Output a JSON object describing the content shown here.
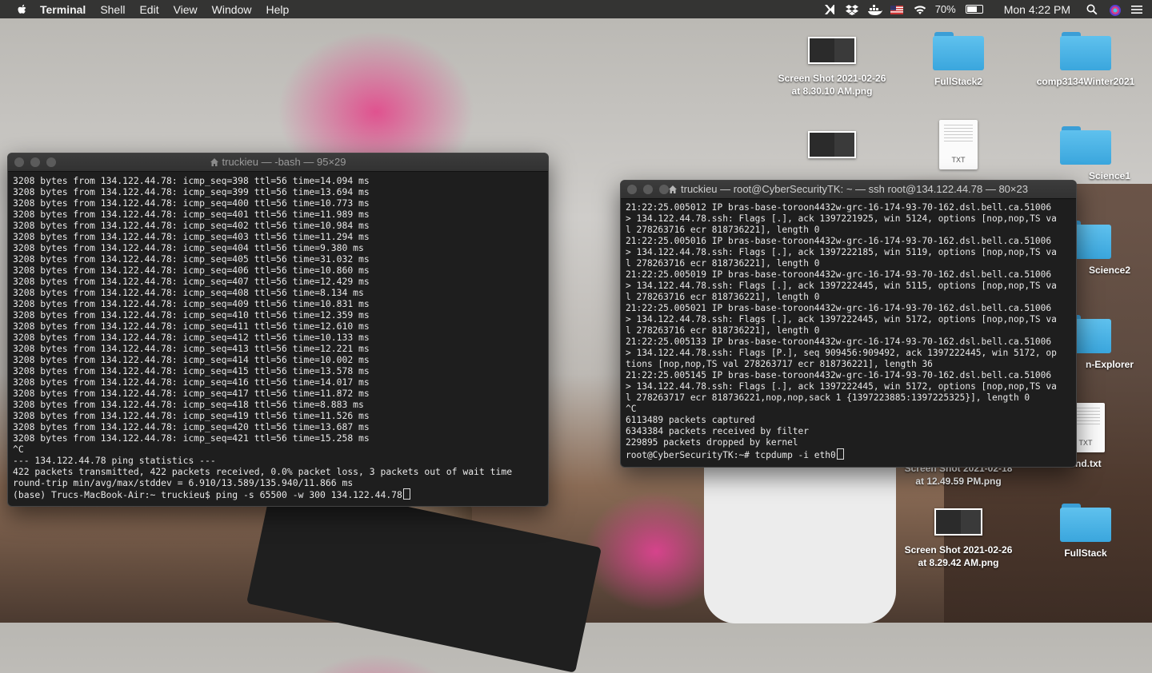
{
  "menubar": {
    "app": "Terminal",
    "menus": [
      "Shell",
      "Edit",
      "View",
      "Window",
      "Help"
    ],
    "battery_percent": "70%",
    "battery_level": 0.7,
    "clock": "Mon 4:22 PM",
    "status_icons": [
      "pinwheel-icon",
      "dropbox-icon",
      "docker-icon",
      "us-flag-icon",
      "wifi-icon",
      "battery-icon",
      "search-icon",
      "siri-icon",
      "menu-list-icon"
    ]
  },
  "desktop": {
    "icons": [
      {
        "label": "Screen Shot 2021-02-26 at 8.30.10 AM.png",
        "kind": "screenshot"
      },
      {
        "label": "FullStack2",
        "kind": "folder"
      },
      {
        "label": "comp3134Winter2021",
        "kind": "folder"
      },
      {
        "label": "",
        "kind": "screenshot"
      },
      {
        "label": "TXT",
        "kind": "txt"
      },
      {
        "label": "Science1",
        "kind": "folder"
      },
      {
        "label": "Science2",
        "kind": "folder"
      },
      {
        "label": "n-Explorer",
        "kind": "folder"
      },
      {
        "label": "Screen Shot 2021-02-18 at 12.49.59 PM.png",
        "kind": "screenshot"
      },
      {
        "label": "end.txt",
        "kind": "txt"
      },
      {
        "label": "Screen Shot 2021-02-26 at 8.29.42 AM.png",
        "kind": "screenshot"
      },
      {
        "label": "FullStack",
        "kind": "folder"
      }
    ],
    "txt_badge": "TXT"
  },
  "term1": {
    "title": "truckieu — -bash — 95×29",
    "lines": [
      "3208 bytes from 134.122.44.78: icmp_seq=398 ttl=56 time=14.094 ms",
      "3208 bytes from 134.122.44.78: icmp_seq=399 ttl=56 time=13.694 ms",
      "3208 bytes from 134.122.44.78: icmp_seq=400 ttl=56 time=10.773 ms",
      "3208 bytes from 134.122.44.78: icmp_seq=401 ttl=56 time=11.989 ms",
      "3208 bytes from 134.122.44.78: icmp_seq=402 ttl=56 time=10.984 ms",
      "3208 bytes from 134.122.44.78: icmp_seq=403 ttl=56 time=11.294 ms",
      "3208 bytes from 134.122.44.78: icmp_seq=404 ttl=56 time=9.380 ms",
      "3208 bytes from 134.122.44.78: icmp_seq=405 ttl=56 time=31.032 ms",
      "3208 bytes from 134.122.44.78: icmp_seq=406 ttl=56 time=10.860 ms",
      "3208 bytes from 134.122.44.78: icmp_seq=407 ttl=56 time=12.429 ms",
      "3208 bytes from 134.122.44.78: icmp_seq=408 ttl=56 time=8.134 ms",
      "3208 bytes from 134.122.44.78: icmp_seq=409 ttl=56 time=10.831 ms",
      "3208 bytes from 134.122.44.78: icmp_seq=410 ttl=56 time=12.359 ms",
      "3208 bytes from 134.122.44.78: icmp_seq=411 ttl=56 time=12.610 ms",
      "3208 bytes from 134.122.44.78: icmp_seq=412 ttl=56 time=10.133 ms",
      "3208 bytes from 134.122.44.78: icmp_seq=413 ttl=56 time=12.221 ms",
      "3208 bytes from 134.122.44.78: icmp_seq=414 ttl=56 time=10.002 ms",
      "3208 bytes from 134.122.44.78: icmp_seq=415 ttl=56 time=13.578 ms",
      "3208 bytes from 134.122.44.78: icmp_seq=416 ttl=56 time=14.017 ms",
      "3208 bytes from 134.122.44.78: icmp_seq=417 ttl=56 time=11.872 ms",
      "3208 bytes from 134.122.44.78: icmp_seq=418 ttl=56 time=8.883 ms",
      "3208 bytes from 134.122.44.78: icmp_seq=419 ttl=56 time=11.526 ms",
      "3208 bytes from 134.122.44.78: icmp_seq=420 ttl=56 time=13.687 ms",
      "3208 bytes from 134.122.44.78: icmp_seq=421 ttl=56 time=15.258 ms",
      "^C",
      "--- 134.122.44.78 ping statistics ---",
      "422 packets transmitted, 422 packets received, 0.0% packet loss, 3 packets out of wait time",
      "round-trip min/avg/max/stddev = 6.910/13.589/135.940/11.866 ms"
    ],
    "prompt": "(base) Trucs-MacBook-Air:~ truckieu$ ping -s 65500 -w 300 134.122.44.78"
  },
  "term2": {
    "title": "truckieu — root@CyberSecurityTK: ~ — ssh root@134.122.44.78 — 80×23",
    "lines": [
      "21:22:25.005012 IP bras-base-toroon4432w-grc-16-174-93-70-162.dsl.bell.ca.51006",
      "> 134.122.44.78.ssh: Flags [.], ack 1397221925, win 5124, options [nop,nop,TS va",
      "l 278263716 ecr 818736221], length 0",
      "21:22:25.005016 IP bras-base-toroon4432w-grc-16-174-93-70-162.dsl.bell.ca.51006",
      "> 134.122.44.78.ssh: Flags [.], ack 1397222185, win 5119, options [nop,nop,TS va",
      "l 278263716 ecr 818736221], length 0",
      "21:22:25.005019 IP bras-base-toroon4432w-grc-16-174-93-70-162.dsl.bell.ca.51006",
      "> 134.122.44.78.ssh: Flags [.], ack 1397222445, win 5115, options [nop,nop,TS va",
      "l 278263716 ecr 818736221], length 0",
      "21:22:25.005021 IP bras-base-toroon4432w-grc-16-174-93-70-162.dsl.bell.ca.51006",
      "> 134.122.44.78.ssh: Flags [.], ack 1397222445, win 5172, options [nop,nop,TS va",
      "l 278263716 ecr 818736221], length 0",
      "21:22:25.005133 IP bras-base-toroon4432w-grc-16-174-93-70-162.dsl.bell.ca.51006",
      "> 134.122.44.78.ssh: Flags [P.], seq 909456:909492, ack 1397222445, win 5172, op",
      "tions [nop,nop,TS val 278263717 ecr 818736221], length 36",
      "21:22:25.005145 IP bras-base-toroon4432w-grc-16-174-93-70-162.dsl.bell.ca.51006",
      "> 134.122.44.78.ssh: Flags [.], ack 1397222445, win 5172, options [nop,nop,TS va",
      "l 278263717 ecr 818736221,nop,nop,sack 1 {1397223885:1397225325}], length 0",
      "^C",
      "6113489 packets captured",
      "6343384 packets received by filter",
      "229895 packets dropped by kernel"
    ],
    "prompt": "root@CyberSecurityTK:~# tcpdump -i eth0"
  }
}
